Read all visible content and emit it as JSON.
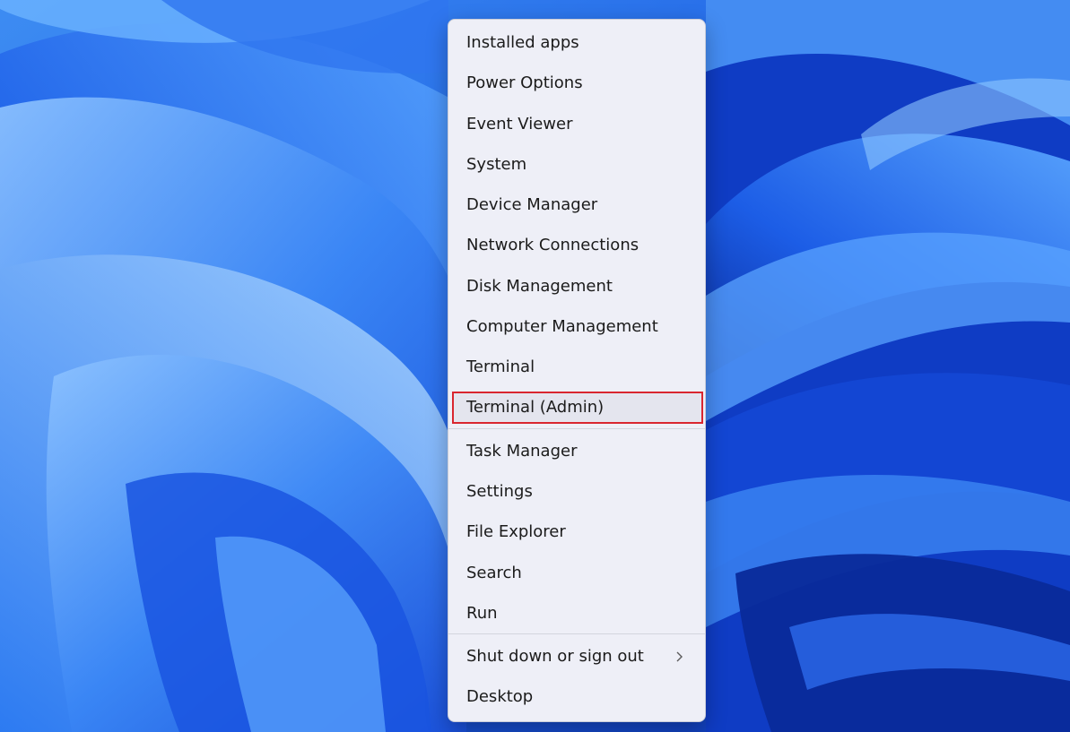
{
  "menu": {
    "group1": [
      {
        "label": "Installed apps"
      },
      {
        "label": "Power Options"
      },
      {
        "label": "Event Viewer"
      },
      {
        "label": "System"
      },
      {
        "label": "Device Manager"
      },
      {
        "label": "Network Connections"
      },
      {
        "label": "Disk Management"
      },
      {
        "label": "Computer Management"
      },
      {
        "label": "Terminal"
      },
      {
        "label": "Terminal (Admin)"
      }
    ],
    "group2": [
      {
        "label": "Task Manager"
      },
      {
        "label": "Settings"
      },
      {
        "label": "File Explorer"
      },
      {
        "label": "Search"
      },
      {
        "label": "Run"
      }
    ],
    "group3": [
      {
        "label": "Shut down or sign out"
      },
      {
        "label": "Desktop"
      }
    ]
  },
  "icons": {
    "submenu": "chevron-right-icon"
  },
  "colors": {
    "highlight_border": "#d9262f",
    "menu_background": "#eeeff7"
  }
}
